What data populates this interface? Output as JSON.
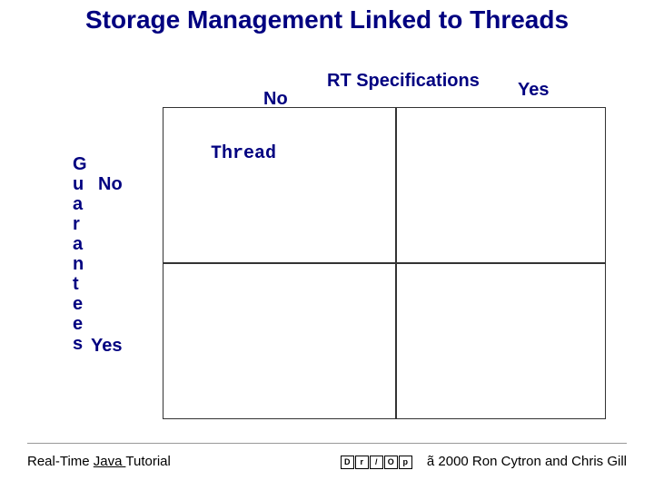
{
  "title": "Storage Management Linked to Threads",
  "axes": {
    "top_label": "RT Specifications",
    "col_no": "No",
    "col_yes": "Yes",
    "side_label": "Guarantees",
    "row_no": "No",
    "row_yes": "Yes"
  },
  "cells": {
    "top_left": "Thread",
    "top_right": "",
    "bottom_left": "",
    "bottom_right": ""
  },
  "footer": {
    "left_plain": "Real-Time ",
    "left_underlined": "Java ",
    "left_tail": "Tutorial",
    "logo_letters": [
      "D",
      "r",
      "/",
      "O",
      "p"
    ],
    "copyright": "ã 2000 Ron Cytron and Chris Gill"
  }
}
